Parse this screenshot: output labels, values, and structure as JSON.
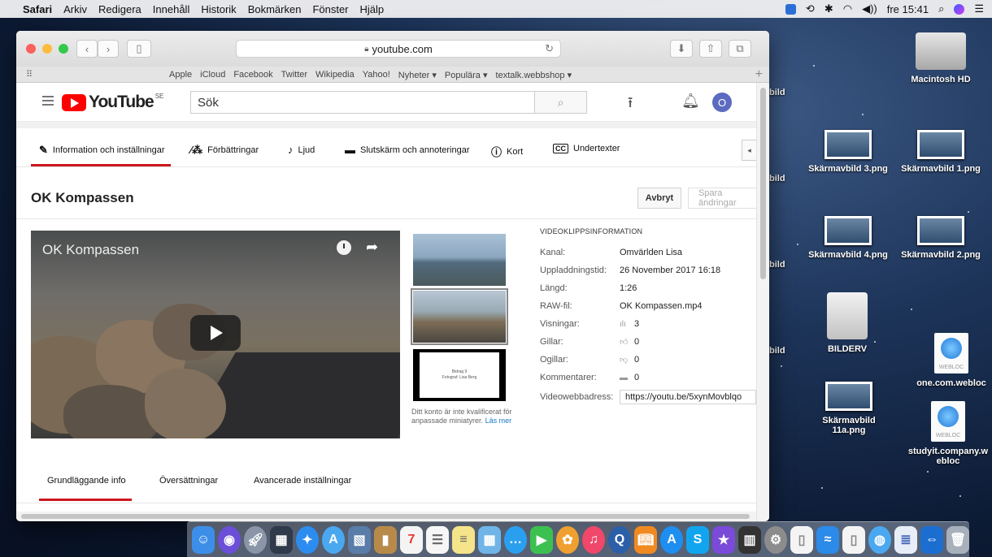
{
  "menubar": {
    "app": "Safari",
    "items": [
      "Arkiv",
      "Redigera",
      "Innehåll",
      "Historik",
      "Bokmärken",
      "Fönster",
      "Hjälp"
    ],
    "clock": "fre 15:41"
  },
  "browser": {
    "url": "youtube.com",
    "favorites": [
      "Apple",
      "iCloud",
      "Facebook",
      "Twitter",
      "Wikipedia",
      "Yahoo!",
      "Nyheter ▾",
      "Populära ▾",
      "textalk.webbshop ▾"
    ]
  },
  "youtube": {
    "logo_text": "YouTube",
    "logo_country": "SE",
    "search_placeholder": "Sök",
    "avatar_letter": "O",
    "tabs": [
      {
        "label": "Information och inställningar",
        "icon": "pencil-icon"
      },
      {
        "label": "Förbättringar",
        "icon": "magic-wand-icon"
      },
      {
        "label": "Ljud",
        "icon": "music-note-icon"
      },
      {
        "label": "Slutskärm och annoteringar",
        "icon": "endscreen-icon"
      },
      {
        "label": "Kort",
        "icon": "info-icon"
      },
      {
        "label": "Undertexter",
        "icon": "cc-icon"
      }
    ],
    "page_title": "OK Kompassen",
    "cancel_button": "Avbryt",
    "save_button": "Spara ändringar",
    "player_title": "OK Kompassen",
    "thumb_card_line1": "Bidrag 9",
    "thumb_card_line2": "Fotograf: Lisa Berg",
    "thumb_note": "Ditt konto är inte kvalificerat för anpassade miniatyrer.",
    "thumb_note_link": "Läs mer",
    "info_heading": "VIDEOKLIPPSINFORMATION",
    "info": {
      "kanal_label": "Kanal:",
      "kanal": "Omvärlden Lisa",
      "upload_label": "Uppladdningstid:",
      "upload": "26 November 2017 16:18",
      "length_label": "Längd:",
      "length": "1:26",
      "raw_label": "RAW-fil:",
      "raw": "OK Kompassen.mp4",
      "views_label": "Visningar:",
      "views": "3",
      "likes_label": "Gillar:",
      "likes": "0",
      "dislikes_label": "Ogillar:",
      "dislikes": "0",
      "comments_label": "Kommentarer:",
      "comments": "0",
      "url_label": "Videowebbadress:",
      "url": "https://youtu.be/5xynMovblqo"
    },
    "bottom_tabs": [
      "Grundläggande info",
      "Översättningar",
      "Avancerade inställningar"
    ]
  },
  "desktop": {
    "partial_labels": [
      "bild",
      "bild",
      "bild",
      "bild"
    ],
    "icons": [
      {
        "label": "Macintosh HD"
      },
      {
        "label": "Skärmavbild 3.png"
      },
      {
        "label": "Skärmavbild 1.png"
      },
      {
        "label": "Skärmavbild 4.png"
      },
      {
        "label": "Skärmavbild 2.png"
      },
      {
        "label": "BILDERV"
      },
      {
        "label": "one.com.webloc"
      },
      {
        "label": "Skärmavbild 11a.png"
      },
      {
        "label": "studyit.company.webloc"
      }
    ],
    "webloc_tag": "WEBLOC"
  },
  "colors": {
    "yt_red": "#ff0000",
    "active_tab_underline": "#cc181e",
    "link_blue": "#167ac6"
  }
}
